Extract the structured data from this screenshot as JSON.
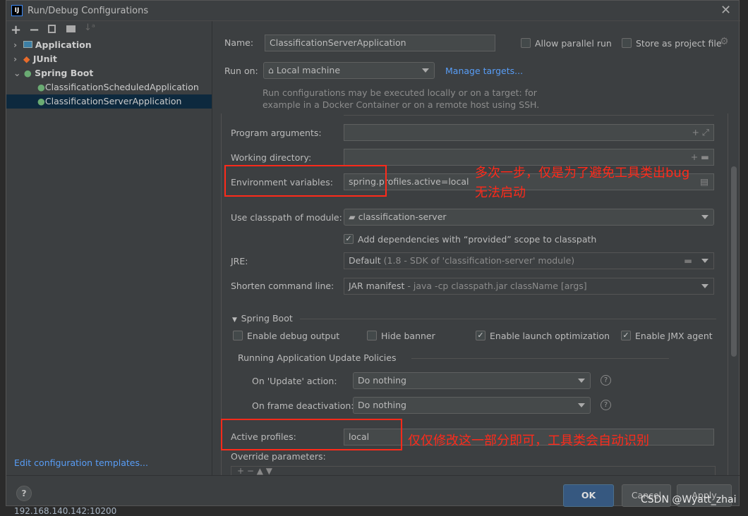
{
  "window": {
    "title": "Run/Debug Configurations",
    "app_icon": "IJ"
  },
  "toolbar": {
    "add": "+",
    "remove": "−"
  },
  "tree": {
    "items": [
      {
        "label": "Application",
        "icon": "application-icon",
        "expanded": false
      },
      {
        "label": "JUnit",
        "icon": "junit-icon",
        "expanded": false
      },
      {
        "label": "Spring Boot",
        "icon": "spring-boot-icon",
        "expanded": true
      },
      {
        "label": "ClassificationScheduledApplication",
        "icon": "spring-boot-icon"
      },
      {
        "label": "ClassificationServerApplication",
        "icon": "spring-boot-icon",
        "selected": true
      }
    ]
  },
  "edit_templates": "Edit configuration templates...",
  "form": {
    "name_label": "Name:",
    "name_value": "ClassificationServerApplication",
    "allow_parallel": "Allow parallel run",
    "store_project": "Store as project file",
    "run_on_label": "Run on:",
    "run_on_value": "Local machine",
    "manage_targets": "Manage targets...",
    "help_line1": "Run configurations may be executed locally or on a target: for",
    "help_line2": "example in a Docker Container or on a remote host using SSH.",
    "program_args": "Program arguments:",
    "working_dir": "Working directory:",
    "env_label": "Environment variables:",
    "env_value": "spring.profiles.active=local",
    "classpath_label": "Use classpath of module:",
    "classpath_value": "classification-server",
    "add_deps": "Add dependencies with “provided” scope to classpath",
    "jre_label": "JRE:",
    "jre_value": "Default",
    "jre_detail": "(1.8 - SDK of 'classification-server' module)",
    "shorten_label": "Shorten command line:",
    "shorten_value": "JAR manifest",
    "shorten_detail": "- java -cp classpath.jar className [args]",
    "spring_section": "Spring Boot",
    "enable_debug": "Enable debug output",
    "hide_banner": "Hide banner",
    "launch_opt": "Enable launch optimization",
    "jmx": "Enable JMX agent",
    "policies": "Running Application Update Policies",
    "update_label": "On 'Update' action:",
    "update_value": "Do nothing",
    "frame_label": "On frame deactivation:",
    "frame_value": "Do nothing",
    "profiles_label": "Active profiles:",
    "profiles_value": "local",
    "override_label": "Override parameters:"
  },
  "checkboxes": {
    "allow_parallel": false,
    "store_project": false,
    "add_deps": true,
    "enable_debug": false,
    "hide_banner": false,
    "launch_opt": true,
    "jmx": true
  },
  "buttons": {
    "ok": "OK",
    "cancel": "Cancel",
    "apply": "Apply",
    "help": "?"
  },
  "annotations": {
    "note1_line1": "多次一步，仅是为了避免工具类出bug",
    "note1_line2": "无法启动",
    "note2": "仅仅修改这一部分即可，工具类会自动识别"
  },
  "watermark": "CSDN @Wyatt_zhai",
  "background_text": "192.168.140.142:10200",
  "colors": {
    "accent": "#589df6",
    "selection": "#0d293e",
    "annotation": "#ff2a1a",
    "ok_button": "#365880"
  }
}
